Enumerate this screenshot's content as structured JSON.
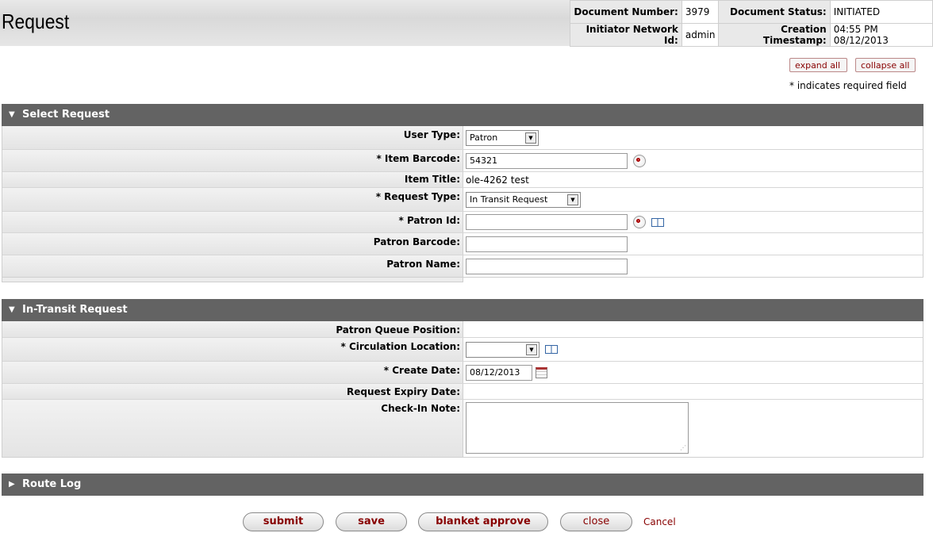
{
  "header": {
    "title": "Request",
    "doc_number_label": "Document Number:",
    "doc_number": "3979",
    "doc_status_label": "Document Status:",
    "doc_status": "INITIATED",
    "initiator_label": "Initiator Network Id:",
    "initiator": "admin",
    "creation_label": "Creation Timestamp:",
    "creation": "04:55 PM 08/12/2013"
  },
  "controls": {
    "expand_all": "expand all",
    "collapse_all": "collapse all",
    "required_note": "* indicates required field"
  },
  "select_request": {
    "title": "Select Request",
    "user_type_label": "User Type:",
    "user_type_value": "Patron",
    "item_barcode_label": "* Item Barcode:",
    "item_barcode_value": "54321",
    "item_title_label": "Item Title:",
    "item_title_value": "ole-4262 test",
    "request_type_label": "* Request Type:",
    "request_type_value": "In Transit Request",
    "patron_id_label": "* Patron Id:",
    "patron_id_value": "",
    "patron_barcode_label": "Patron Barcode:",
    "patron_barcode_value": "",
    "patron_name_label": "Patron Name:",
    "patron_name_value": ""
  },
  "in_transit": {
    "title": "In-Transit Request",
    "queue_label": "Patron Queue Position:",
    "circ_location_label": "* Circulation Location:",
    "circ_location_value": "",
    "create_date_label": "* Create Date:",
    "create_date_value": "08/12/2013",
    "expiry_label": "Request Expiry Date:",
    "checkin_note_label": "Check-In Note:"
  },
  "route_log": {
    "title": "Route Log"
  },
  "actions": {
    "submit": "submit",
    "save": "save",
    "blanket_approve": "blanket approve",
    "close": "close",
    "cancel": "Cancel"
  },
  "icons": [
    "lookup-icon",
    "inquiry-book-icon",
    "calendar-icon",
    "dropdown-arrow-icon"
  ]
}
